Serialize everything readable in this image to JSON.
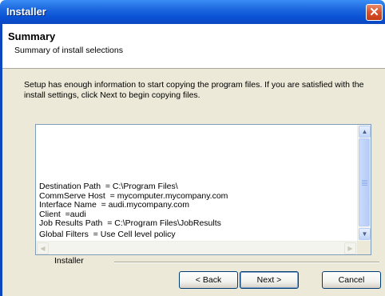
{
  "window": {
    "title": "Installer"
  },
  "header": {
    "title": "Summary",
    "subtitle": "Summary of install selections"
  },
  "intro_text": "Setup has enough information to start copying the program files.  If you are satisfied with the install settings, click Next to begin copying files.",
  "summary_lines": [
    "Destination Path  = C:\\Program Files\\",
    "CommServe Host  = mycomputer.mycompany.com",
    "Interface Name  = audi.mycompany.com",
    "Client  =audi",
    "Job Results Path  = C:\\Program Files\\JobResults",
    "Global Filters  = Use Cell level policy"
  ],
  "footer": {
    "group_label": "Installer"
  },
  "buttons": {
    "back": "< Back",
    "next": "Next >",
    "cancel": "Cancel"
  }
}
